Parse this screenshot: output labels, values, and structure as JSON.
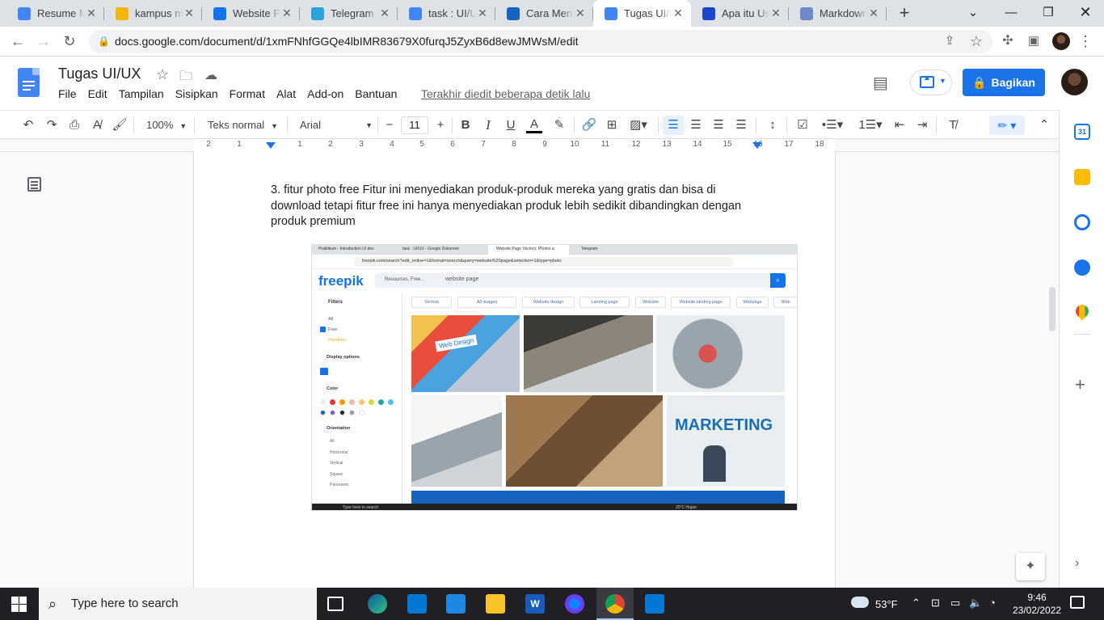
{
  "browser": {
    "tabs": [
      {
        "title": "Resume Mata Kuliah",
        "favicon": "gmail-icon",
        "color": "#4285f4"
      },
      {
        "title": "kampus merdeka",
        "favicon": "slides-icon",
        "color": "#f4b400"
      },
      {
        "title": "Website Page",
        "favicon": "freepik-icon",
        "color": "#1273eb"
      },
      {
        "title": "Telegram",
        "favicon": "telegram-icon",
        "color": "#2aa3df"
      },
      {
        "title": "task : UI/UX",
        "favicon": "docs-icon",
        "color": "#4285f4"
      },
      {
        "title": "Cara Menentukan",
        "favicon": "cara-icon",
        "color": "#1565c0"
      },
      {
        "title": "Tugas UI/UX",
        "favicon": "docs-icon",
        "color": "#4285f4",
        "active": true
      },
      {
        "title": "Apa itu User",
        "favicon": "site-icon",
        "color": "#1a47c9"
      },
      {
        "title": "Markdown",
        "favicon": "r-icon",
        "color": "#6f88c9"
      }
    ],
    "url": "docs.google.com/document/d/1xmFNhfGGQe4lbIMR83679X0furqJ5ZyxB6d8ewJMWsM/edit"
  },
  "docs": {
    "title": "Tugas UI/UX",
    "menus": [
      "File",
      "Edit",
      "Tampilan",
      "Sisipkan",
      "Format",
      "Alat",
      "Add-on",
      "Bantuan"
    ],
    "last_edit": "Terakhir diedit beberapa detik lalu",
    "share_label": "Bagikan",
    "toolbar": {
      "zoom": "100%",
      "style": "Teks normal",
      "font": "Arial",
      "font_size": "11"
    },
    "ruler_numbers": [
      "2",
      "1",
      "1",
      "2",
      "3",
      "4",
      "5",
      "6",
      "7",
      "8",
      "9",
      "10",
      "11",
      "12",
      "13",
      "14",
      "15",
      "16",
      "17",
      "18"
    ],
    "paragraph": "3. fitur photo free Fitur ini menyediakan produk-produk mereka yang gratis dan bisa di download tetapi fitur free ini hanya menyediakan produk lebih sedikit dibandingkan dengan produk premium"
  },
  "embedded": {
    "tabs": [
      "Praktikum - Introduction UI des",
      "task : UI/UX - Google Dokumen",
      "Website Page Vectors, Photos a",
      "Telegram"
    ],
    "url": "freepik.com/search?edit_online=1&format=search&query=website%20page&selection=1&type=photo",
    "logo": "freepik",
    "search_scope": "Resources, Free...",
    "search_query": "website page",
    "chips": [
      "Vectors",
      "All images",
      "Website design",
      "Landing page",
      "Website",
      "Website landing page",
      "Webpage",
      "Web"
    ],
    "filters_title": "Filters",
    "filter_all": "All",
    "filter_free": "Free",
    "filter_premium": "Premium",
    "display_options": "Display options",
    "color_title": "Color",
    "orientation_title": "Orientation",
    "orientation_options": [
      "All",
      "Horizontal",
      "Vertical",
      "Square",
      "Panoramic"
    ],
    "marketing_text": "MARKETING",
    "webdesign_text": "Web Design",
    "taskbar_search": "Type here to search",
    "weather": "25°C Hujan"
  },
  "taskbar": {
    "search_placeholder": "Type here to search",
    "weather": "53°F",
    "time": "9:46",
    "date": "23/02/2022"
  }
}
